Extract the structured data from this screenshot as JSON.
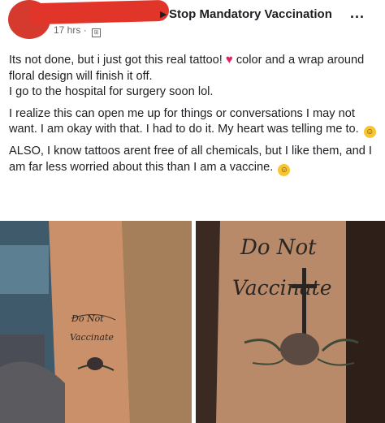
{
  "post": {
    "group_name": "Stop Mandatory Vaccination",
    "more_label": "...",
    "time": "17 hrs",
    "paragraphs": [
      {
        "text_before": "Its not done, but i just got this real tattoo! ",
        "emoji": "♥",
        "text_after": "  color and a wrap around floral design will finish it off."
      },
      {
        "text": "I go to the hospital for surgery soon lol."
      },
      {
        "text": "I realize this can open me up for things or conversations I may not want. I am okay with that. I had to do it. My heart was telling me to.",
        "emoji": "☺"
      },
      {
        "text": "ALSO, I know tattoos arent free of all chemicals, but I like them, and I am far less worried about this than I am a vaccine.",
        "emoji": "☺"
      }
    ]
  },
  "photos": {
    "tattoo_line1": "Do Not",
    "tattoo_line2": "Vaccinate"
  }
}
